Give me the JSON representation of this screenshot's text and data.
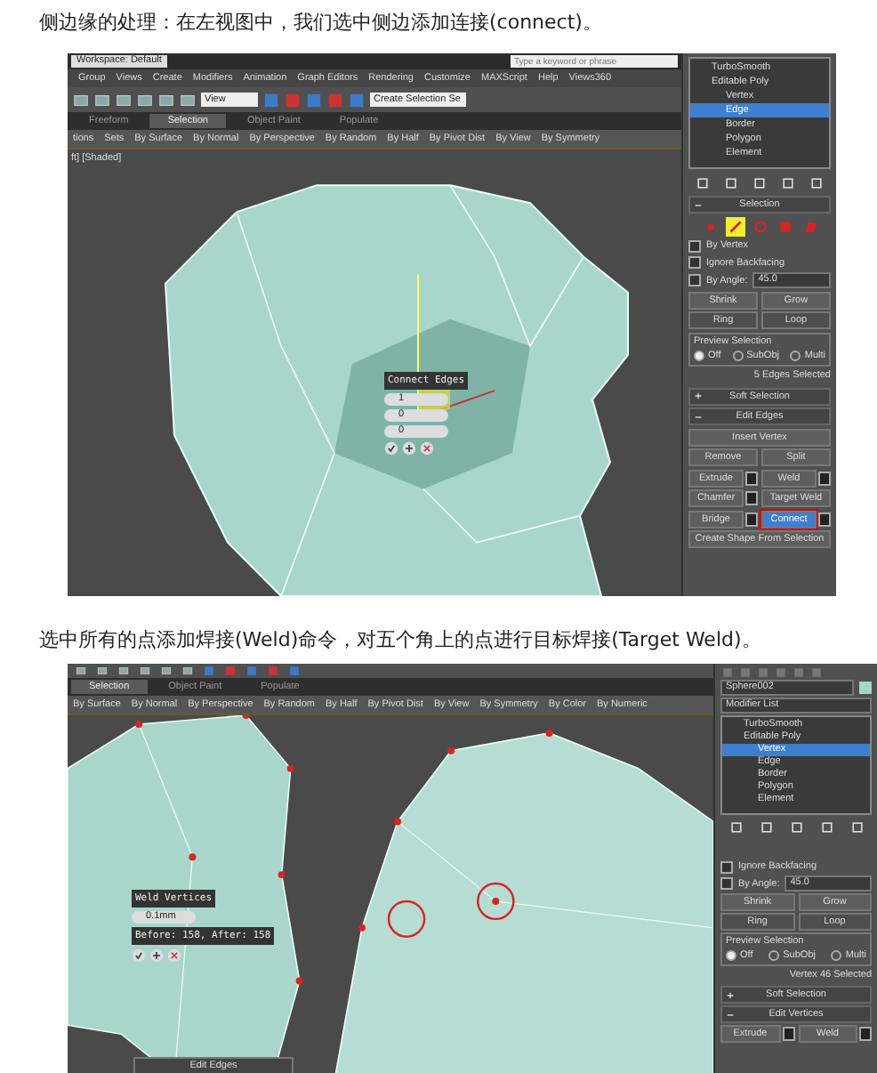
{
  "sections": [
    {
      "caption": "侧边缘的处理：在左视图中，我们选中侧边添加连接(connect)。",
      "screenshot": {
        "title_bar": {
          "workspace": "Workspace: Default",
          "search": {
            "placeholder": "Type a keyword or phrase"
          }
        },
        "menu": [
          "Group",
          "Views",
          "Create",
          "Modifiers",
          "Animation",
          "Graph Editors",
          "Rendering",
          "Customize",
          "MAXScript",
          "Help",
          "Views360"
        ],
        "toolbar": {
          "view_dropdown": "View",
          "selection_set": "Create Selection Se"
        },
        "ribbon_tabs": [
          {
            "label": "Freeform",
            "selected": false
          },
          {
            "label": "Selection",
            "selected": true
          },
          {
            "label": "Object Paint",
            "selected": false
          },
          {
            "label": "Populate",
            "selected": false
          }
        ],
        "ribbon_tools": [
          "tions",
          "Sets",
          "By Surface",
          "By Normal",
          "By Perspective",
          "By Random",
          "By Half",
          "By Pivot Dist",
          "By View",
          "By Symmetry"
        ],
        "viewport": {
          "label": "ft] [Shaded]",
          "kind": "edge",
          "caddy": {
            "title": "Connect Edges",
            "fields": [
              "1",
              "0",
              "0"
            ]
          }
        },
        "panel": [
          {
            "kind": "stack",
            "items": [
              {
                "label": "TurboSmooth",
                "selected": false
              },
              {
                "label": "Editable Poly",
                "selected": false,
                "children": [
                  {
                    "label": "Vertex",
                    "selected": false
                  },
                  {
                    "label": "Edge",
                    "selected": true
                  },
                  {
                    "label": "Border",
                    "selected": false
                  },
                  {
                    "label": "Polygon",
                    "selected": false
                  },
                  {
                    "label": "Element",
                    "selected": false
                  }
                ]
              }
            ]
          },
          {
            "kind": "stack-tools"
          },
          {
            "kind": "rollout",
            "expanded": true,
            "title": "Selection"
          },
          {
            "kind": "subobject",
            "items": [
              {
                "selected": false
              },
              {
                "selected": true
              },
              {
                "selected": false
              },
              {
                "selected": false
              },
              {
                "selected": false
              }
            ]
          },
          {
            "kind": "checkbox",
            "label": "By Vertex",
            "checked": false
          },
          {
            "kind": "checkbox",
            "label": "Ignore Backfacing",
            "checked": false
          },
          {
            "kind": "angle",
            "label": "By Angle:",
            "checked": false,
            "value": "45.0"
          },
          {
            "kind": "buttons",
            "items": [
              "Shrink",
              "Grow"
            ]
          },
          {
            "kind": "spinners",
            "items": [
              "Ring",
              "Loop"
            ]
          },
          {
            "kind": "radio-group",
            "title": "Preview Selection",
            "options": [
              {
                "label": "Off",
                "selected": true
              },
              {
                "label": "SubObj",
                "selected": false
              },
              {
                "label": "Multi",
                "selected": false
              }
            ]
          },
          {
            "kind": "status",
            "text": "5 Edges Selected"
          },
          {
            "kind": "rollout",
            "expanded": false,
            "title": "Soft Selection"
          },
          {
            "kind": "rollout",
            "expanded": true,
            "title": "Edit Edges"
          },
          {
            "kind": "buttons",
            "items": [
              "Insert Vertex"
            ]
          },
          {
            "kind": "buttons",
            "items": [
              "Remove",
              "Split"
            ]
          },
          {
            "kind": "setting-buttons",
            "items": [
              {
                "label": "Extrude",
                "active": false,
                "settings": true
              },
              {
                "label": "Weld",
                "active": false,
                "settings": true
              }
            ]
          },
          {
            "kind": "setting-buttons",
            "items": [
              {
                "label": "Chamfer",
                "active": false,
                "settings": true
              },
              {
                "label": "Target Weld",
                "active": false,
                "settings": false
              }
            ]
          },
          {
            "kind": "setting-buttons",
            "items": [
              {
                "label": "Bridge",
                "active": false,
                "settings": true
              },
              {
                "label": "Connect",
                "active": true,
                "settings": true
              }
            ]
          },
          {
            "kind": "buttons",
            "items": [
              "Create Shape From Selection"
            ]
          }
        ]
      }
    },
    {
      "caption": "选中所有的点添加焊接(Weld)命令，对五个角上的点进行目标焊接(Target Weld)。",
      "screenshot": {
        "ribbon_tabs": [
          {
            "label": "Selection",
            "selected": true
          },
          {
            "label": "Object Paint",
            "selected": false
          },
          {
            "label": "Populate",
            "selected": false
          }
        ],
        "ribbon_tools": [
          "By Surface",
          "By Normal",
          "By Perspective",
          "By Random",
          "By Half",
          "By Pivot Dist",
          "By View",
          "By Symmetry",
          "By Color",
          "By Numeric"
        ],
        "viewport": {
          "kind": "vertex",
          "caddy": {
            "title": "Weld Vertices",
            "fields": [
              "0.1mm"
            ],
            "info": "Before: 158, After: 158"
          },
          "bottom_rollout": "Edit Edges"
        },
        "panel": [
          {
            "kind": "panel-tabs"
          },
          {
            "kind": "name-field",
            "value": "Sphere002"
          },
          {
            "kind": "dropdown",
            "value": "Modifier List"
          },
          {
            "kind": "stack",
            "items": [
              {
                "label": "TurboSmooth",
                "selected": false
              },
              {
                "label": "Editable Poly",
                "selected": false,
                "children": [
                  {
                    "label": "Vertex",
                    "selected": true
                  },
                  {
                    "label": "Edge",
                    "selected": false
                  },
                  {
                    "label": "Border",
                    "selected": false
                  },
                  {
                    "label": "Polygon",
                    "selected": false
                  },
                  {
                    "label": "Element",
                    "selected": false
                  }
                ]
              }
            ]
          },
          {
            "kind": "stack-tools"
          },
          {
            "kind": "spacer"
          },
          {
            "kind": "checkbox",
            "label": "Ignore Backfacing",
            "checked": false
          },
          {
            "kind": "angle",
            "label": "By Angle:",
            "checked": false,
            "value": "45.0"
          },
          {
            "kind": "buttons",
            "items": [
              "Shrink",
              "Grow"
            ]
          },
          {
            "kind": "spinners",
            "items": [
              "Ring",
              "Loop"
            ]
          },
          {
            "kind": "radio-group",
            "title": "Preview Selection",
            "options": [
              {
                "label": "Off",
                "selected": true
              },
              {
                "label": "SubObj",
                "selected": false
              },
              {
                "label": "Multi",
                "selected": false
              }
            ]
          },
          {
            "kind": "status",
            "text": "Vertex 46 Selected"
          },
          {
            "kind": "rollout",
            "expanded": false,
            "title": "Soft Selection"
          },
          {
            "kind": "rollout",
            "expanded": true,
            "title": "Edit Vertices"
          },
          {
            "kind": "setting-buttons",
            "items": [
              {
                "label": "Extrude",
                "active": false,
                "settings": true
              },
              {
                "label": "Weld",
                "active": false,
                "settings": true
              }
            ]
          }
        ]
      }
    }
  ]
}
